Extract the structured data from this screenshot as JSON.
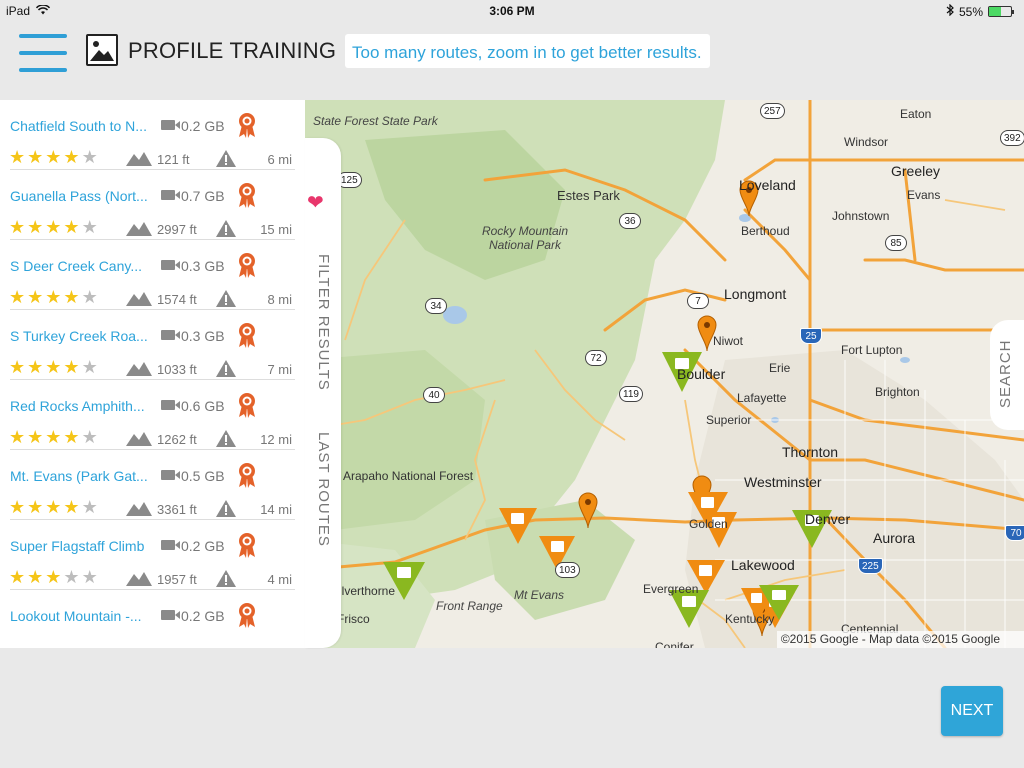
{
  "status_bar": {
    "device": "iPad",
    "time": "3:06 PM",
    "battery": "55%",
    "battery_level": 0.55
  },
  "header": {
    "title": "PROFILE TRAINING",
    "hint": "Too many routes, zoom in to get better results."
  },
  "routes": [
    {
      "name": "Chatfield South to N...",
      "size": "0.2 GB",
      "rating": 4,
      "elevation": "121 ft",
      "distance": "6 mi"
    },
    {
      "name": "Guanella Pass (Nort...",
      "size": "0.7 GB",
      "rating": 4,
      "elevation": "2997 ft",
      "distance": "15 mi"
    },
    {
      "name": "S Deer Creek Cany...",
      "size": "0.3 GB",
      "rating": 4,
      "elevation": "1574 ft",
      "distance": "8 mi"
    },
    {
      "name": "S Turkey Creek Roa...",
      "size": "0.3 GB",
      "rating": 4,
      "elevation": "1033 ft",
      "distance": "7 mi"
    },
    {
      "name": "Red Rocks Amphith...",
      "size": "0.6 GB",
      "rating": 4,
      "elevation": "1262 ft",
      "distance": "12 mi"
    },
    {
      "name": "Mt. Evans (Park Gat...",
      "size": "0.5 GB",
      "rating": 4,
      "elevation": "3361 ft",
      "distance": "14 mi"
    },
    {
      "name": "Super Flagstaff Climb",
      "size": "0.2 GB",
      "rating": 3,
      "elevation": "1957 ft",
      "distance": "4 mi"
    },
    {
      "name": "Lookout Mountain -...",
      "size": "0.2 GB",
      "rating": 0,
      "elevation": "",
      "distance": ""
    }
  ],
  "tabs": {
    "filter": "FILTER RESULTS",
    "last": "LAST ROUTES",
    "search": "SEARCH"
  },
  "map": {
    "places": [
      "State Forest State Park",
      "Estes Park",
      "Rocky Mountain National Park",
      "Loveland",
      "Berthoud",
      "Johnstown",
      "Windsor",
      "Eaton",
      "Greeley",
      "Evans",
      "Longmont",
      "Niwot",
      "Boulder",
      "Erie",
      "Fort Lupton",
      "Brighton",
      "Lafayette",
      "Superior",
      "Thornton",
      "Westminster",
      "Denver",
      "Aurora",
      "Golden",
      "Lakewood",
      "Evergreen",
      "Kentucky",
      "Centennial",
      "Conifer",
      "Silverthorne",
      "Frisco",
      "Front Range",
      "Mt Evans",
      "Arapaho National Forest"
    ],
    "highways": [
      "257",
      "392",
      "125",
      "36",
      "85",
      "34",
      "7",
      "25",
      "72",
      "119",
      "40",
      "103",
      "225",
      "70"
    ],
    "attribution": "©2015 Google - Map data ©2015 Google"
  },
  "next_label": "NEXT",
  "colors": {
    "accent": "#2ea3da",
    "star": "#f5c518",
    "award": "#e4622a",
    "marker_orange": "#f08c12",
    "marker_green": "#8ab820",
    "heart": "#e8366c"
  }
}
